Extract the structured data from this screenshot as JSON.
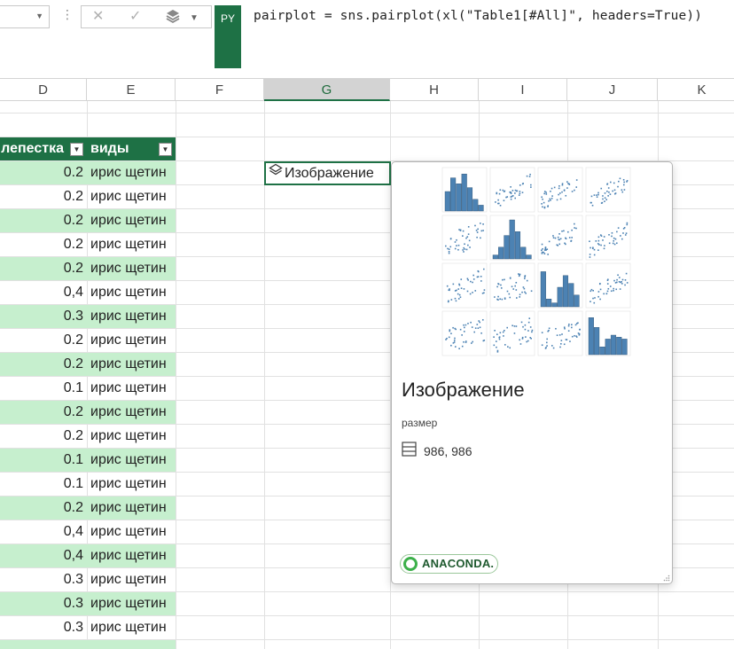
{
  "formula_bar": {
    "badge": "PY",
    "formula": "pairplot = sns.pairplot(xl(\"Table1[#All]\", headers=True))"
  },
  "columns": [
    "D",
    "E",
    "F",
    "G",
    "H",
    "I",
    "J",
    "K"
  ],
  "selected_column": "G",
  "table": {
    "headers": [
      "лепестка",
      "виды"
    ],
    "rows": [
      {
        "value": "0.2",
        "species": "ирис щетин"
      },
      {
        "value": "0.2",
        "species": "ирис щетин"
      },
      {
        "value": "0.2",
        "species": "ирис щетин"
      },
      {
        "value": "0.2",
        "species": "ирис щетин"
      },
      {
        "value": "0.2",
        "species": "ирис щетин"
      },
      {
        "value": "0,4",
        "species": "ирис щетин"
      },
      {
        "value": "0.3",
        "species": "ирис щетин"
      },
      {
        "value": "0.2",
        "species": "ирис щетин"
      },
      {
        "value": "0.2",
        "species": "ирис щетин"
      },
      {
        "value": "0.1",
        "species": "ирис щетин"
      },
      {
        "value": "0.2",
        "species": "ирис щетин"
      },
      {
        "value": "0.2",
        "species": "ирис щетин"
      },
      {
        "value": "0.1",
        "species": "ирис щетин"
      },
      {
        "value": "0.1",
        "species": "ирис щетин"
      },
      {
        "value": "0.2",
        "species": "ирис щетин"
      },
      {
        "value": "0,4",
        "species": "ирис щетин"
      },
      {
        "value": "0,4",
        "species": "ирис щетин"
      },
      {
        "value": "0.3",
        "species": "ирис щетин"
      },
      {
        "value": "0.3",
        "species": "ирис щетин"
      },
      {
        "value": "0.3",
        "species": "ирис щетин"
      }
    ]
  },
  "image_cell": {
    "label": "Изображение",
    "icon": "layers-icon"
  },
  "card": {
    "title": "Изображение",
    "size_label": "размер",
    "size_value": "986, 986",
    "size_icon": "table-grid-icon",
    "brand": "ANACONDA."
  },
  "colors": {
    "excel_green": "#1e7145",
    "band_green": "#c6efce",
    "plot_blue": "#4c82b3"
  }
}
